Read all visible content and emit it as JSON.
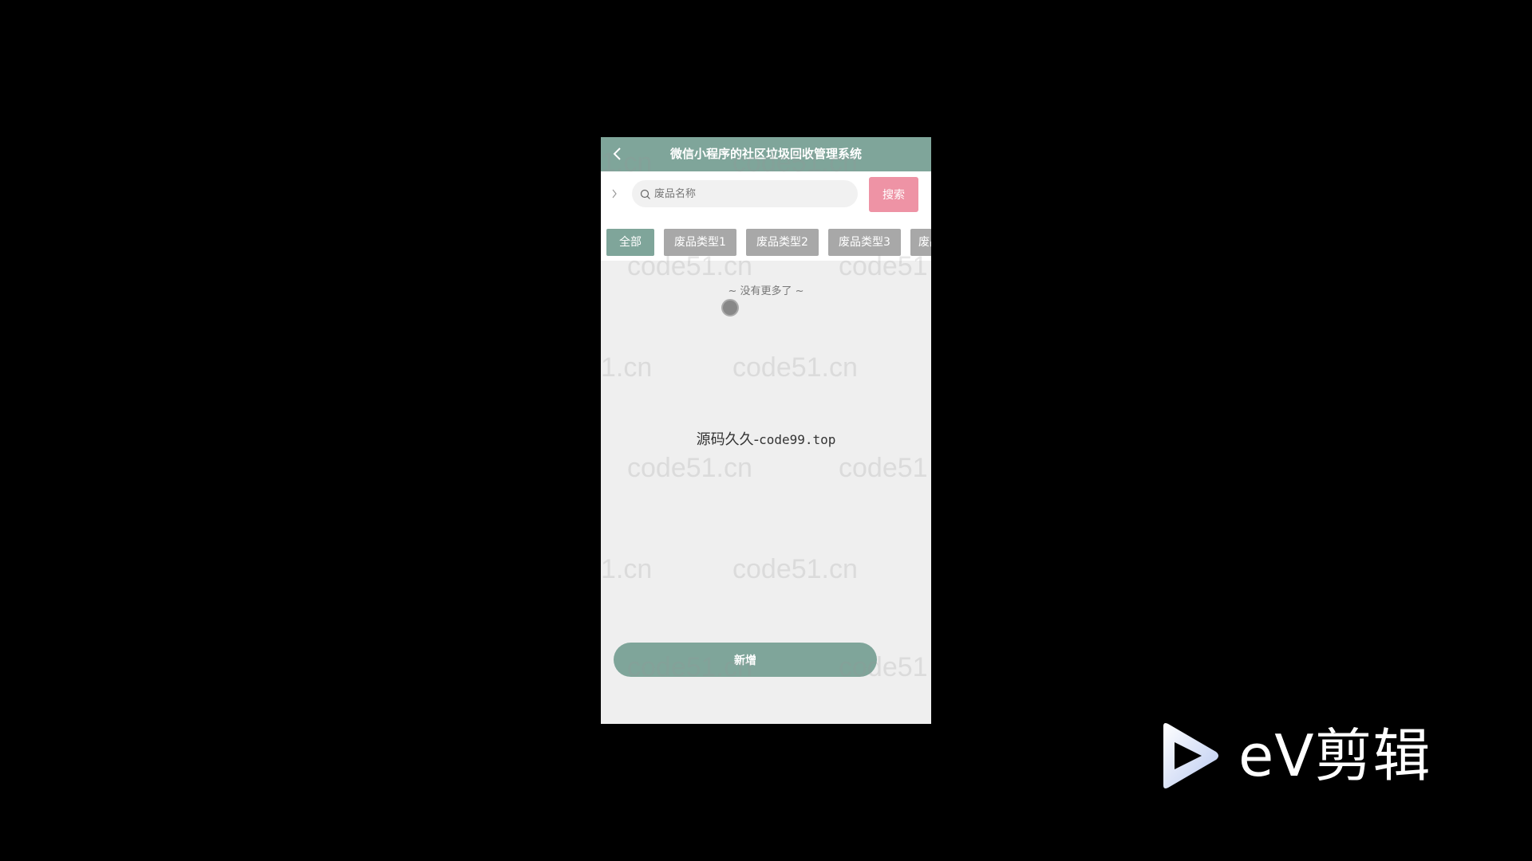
{
  "app": {
    "title": "微信小程序的社区垃圾回收管理系统"
  },
  "search": {
    "placeholder": "废品名称",
    "value": "",
    "button_label": "搜索"
  },
  "tabs": [
    {
      "label": "全部",
      "active": true
    },
    {
      "label": "废品类型1",
      "active": false
    },
    {
      "label": "废品类型2",
      "active": false
    },
    {
      "label": "废品类型3",
      "active": false
    },
    {
      "label": "废品",
      "active": false
    }
  ],
  "list": {
    "end_text": "~ 没有更多了 ~"
  },
  "overlay": {
    "center_text_cn": "源码久久-",
    "center_text_en": "code99.top"
  },
  "watermark": {
    "text": "code51.cn",
    "partial_text": "1.cn",
    "cut_text": "code51"
  },
  "actions": {
    "add_label": "新增"
  },
  "video_logo": {
    "text": "eV剪辑",
    "icon": "play-icon"
  },
  "colors": {
    "primary": "#7fa59a",
    "search_button": "#ee93a5",
    "tab_inactive": "#a8a8a8",
    "background": "#000000",
    "content_bg": "#efefef"
  },
  "icons": {
    "back": "back-arrow-icon",
    "chevron": "chevron-right-icon",
    "search": "search-icon"
  }
}
